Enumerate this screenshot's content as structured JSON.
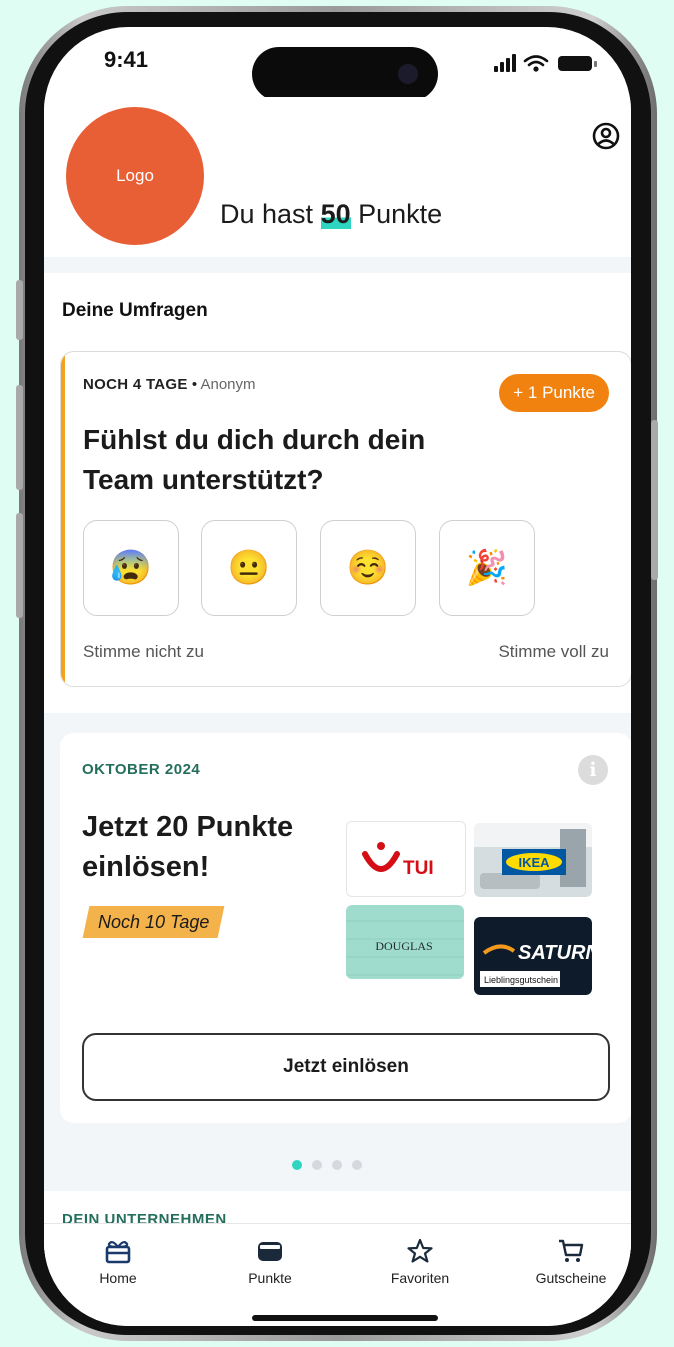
{
  "status_bar": {
    "time": "9:41"
  },
  "header": {
    "logo_label": "Logo",
    "points_prefix": "Du hast",
    "points_value": "50",
    "points_suffix": "Punkte"
  },
  "surveys": {
    "section_title": "Deine Umfragen",
    "card": {
      "days_left": "NOCH 4 TAGE",
      "separator": "•",
      "anonymity": "Anonym",
      "reward_badge": "+ 1 Punkte",
      "question": "Fühlst du dich durch dein Team unterstützt?",
      "options": [
        "😰",
        "😐",
        "☺️",
        "🎉"
      ],
      "scale_min_label": "Stimme nicht zu",
      "scale_max_label": "Stimme voll zu"
    }
  },
  "promo": {
    "month": "OKTOBER 2024",
    "title": "Jetzt 20 Punkte einlösen!",
    "deadline": "Noch 10 Tage",
    "vouchers": [
      {
        "brand": "TUI"
      },
      {
        "brand": "IKEA"
      },
      {
        "brand": "DOUGLAS"
      },
      {
        "brand": "SATURN",
        "subtitle": "Lieblingsgutschein"
      }
    ],
    "cta_label": "Jetzt einlösen",
    "carousel_count": 4,
    "carousel_active": 1
  },
  "company": {
    "section_title": "DEIN UNTERNEHMEN"
  },
  "tabbar": {
    "items": [
      {
        "label": "Home",
        "icon": "gift-icon"
      },
      {
        "label": "Punkte",
        "icon": "wallet-icon"
      },
      {
        "label": "Favoriten",
        "icon": "star-icon"
      },
      {
        "label": "Gutscheine",
        "icon": "cart-icon"
      }
    ]
  },
  "colors": {
    "accent_teal": "#2ed6c1",
    "logo_orange": "#e85f36",
    "badge_orange": "#f2820f",
    "deadline_yellow": "#f4b24a",
    "section_green": "#246e5c",
    "page_background": "#dffdf2"
  }
}
